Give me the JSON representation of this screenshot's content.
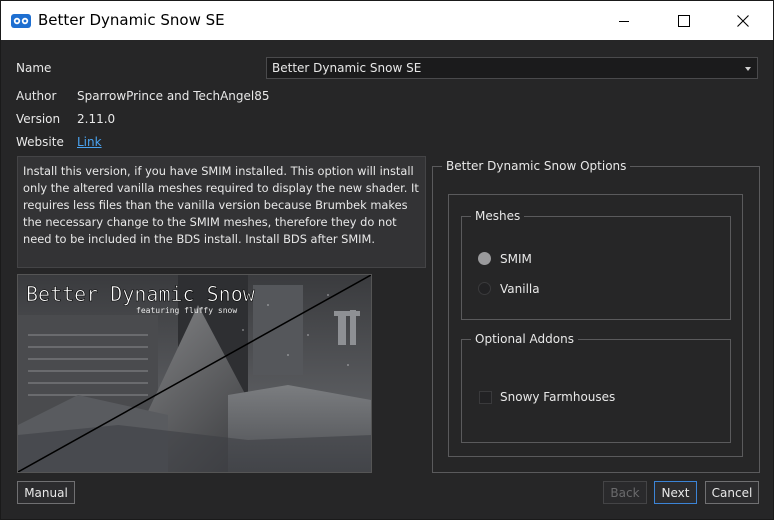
{
  "window": {
    "title": "Better Dynamic Snow SE"
  },
  "icons": {
    "app": "app-logo-icon",
    "minimize": "minimize-icon",
    "maximize": "maximize-icon",
    "close": "close-icon",
    "dropdown": "chevron-down-icon"
  },
  "fields": {
    "name_label": "Name",
    "name_value": "Better Dynamic Snow SE",
    "author_label": "Author",
    "author_value": "SparrowPrince and TechAngel85",
    "version_label": "Version",
    "version_value": "2.11.0",
    "website_label": "Website",
    "website_link": "Link"
  },
  "description": "Install this version, if you have SMIM installed. This option will install only the altered vanilla meshes required to display the new shader. It requires less files than the vanilla version because Brumbek makes the necessary change to the SMIM meshes, therefore they do not need to be included in the BDS install. Install BDS after SMIM.",
  "preview": {
    "title": "Better Dynamic Snow",
    "subtitle": "featuring fluffy snow"
  },
  "options": {
    "group_title": "Better Dynamic Snow Options",
    "meshes": {
      "title": "Meshes",
      "items": [
        {
          "label": "SMIM",
          "selected": true
        },
        {
          "label": "Vanilla",
          "selected": false
        }
      ]
    },
    "addons": {
      "title": "Optional Addons",
      "items": [
        {
          "label": "Snowy Farmhouses",
          "checked": false
        }
      ]
    }
  },
  "buttons": {
    "manual": "Manual",
    "back": "Back",
    "next": "Next",
    "cancel": "Cancel"
  },
  "colors": {
    "background": "#262627",
    "accent": "#3c84d6",
    "link": "#4aa3f0"
  }
}
